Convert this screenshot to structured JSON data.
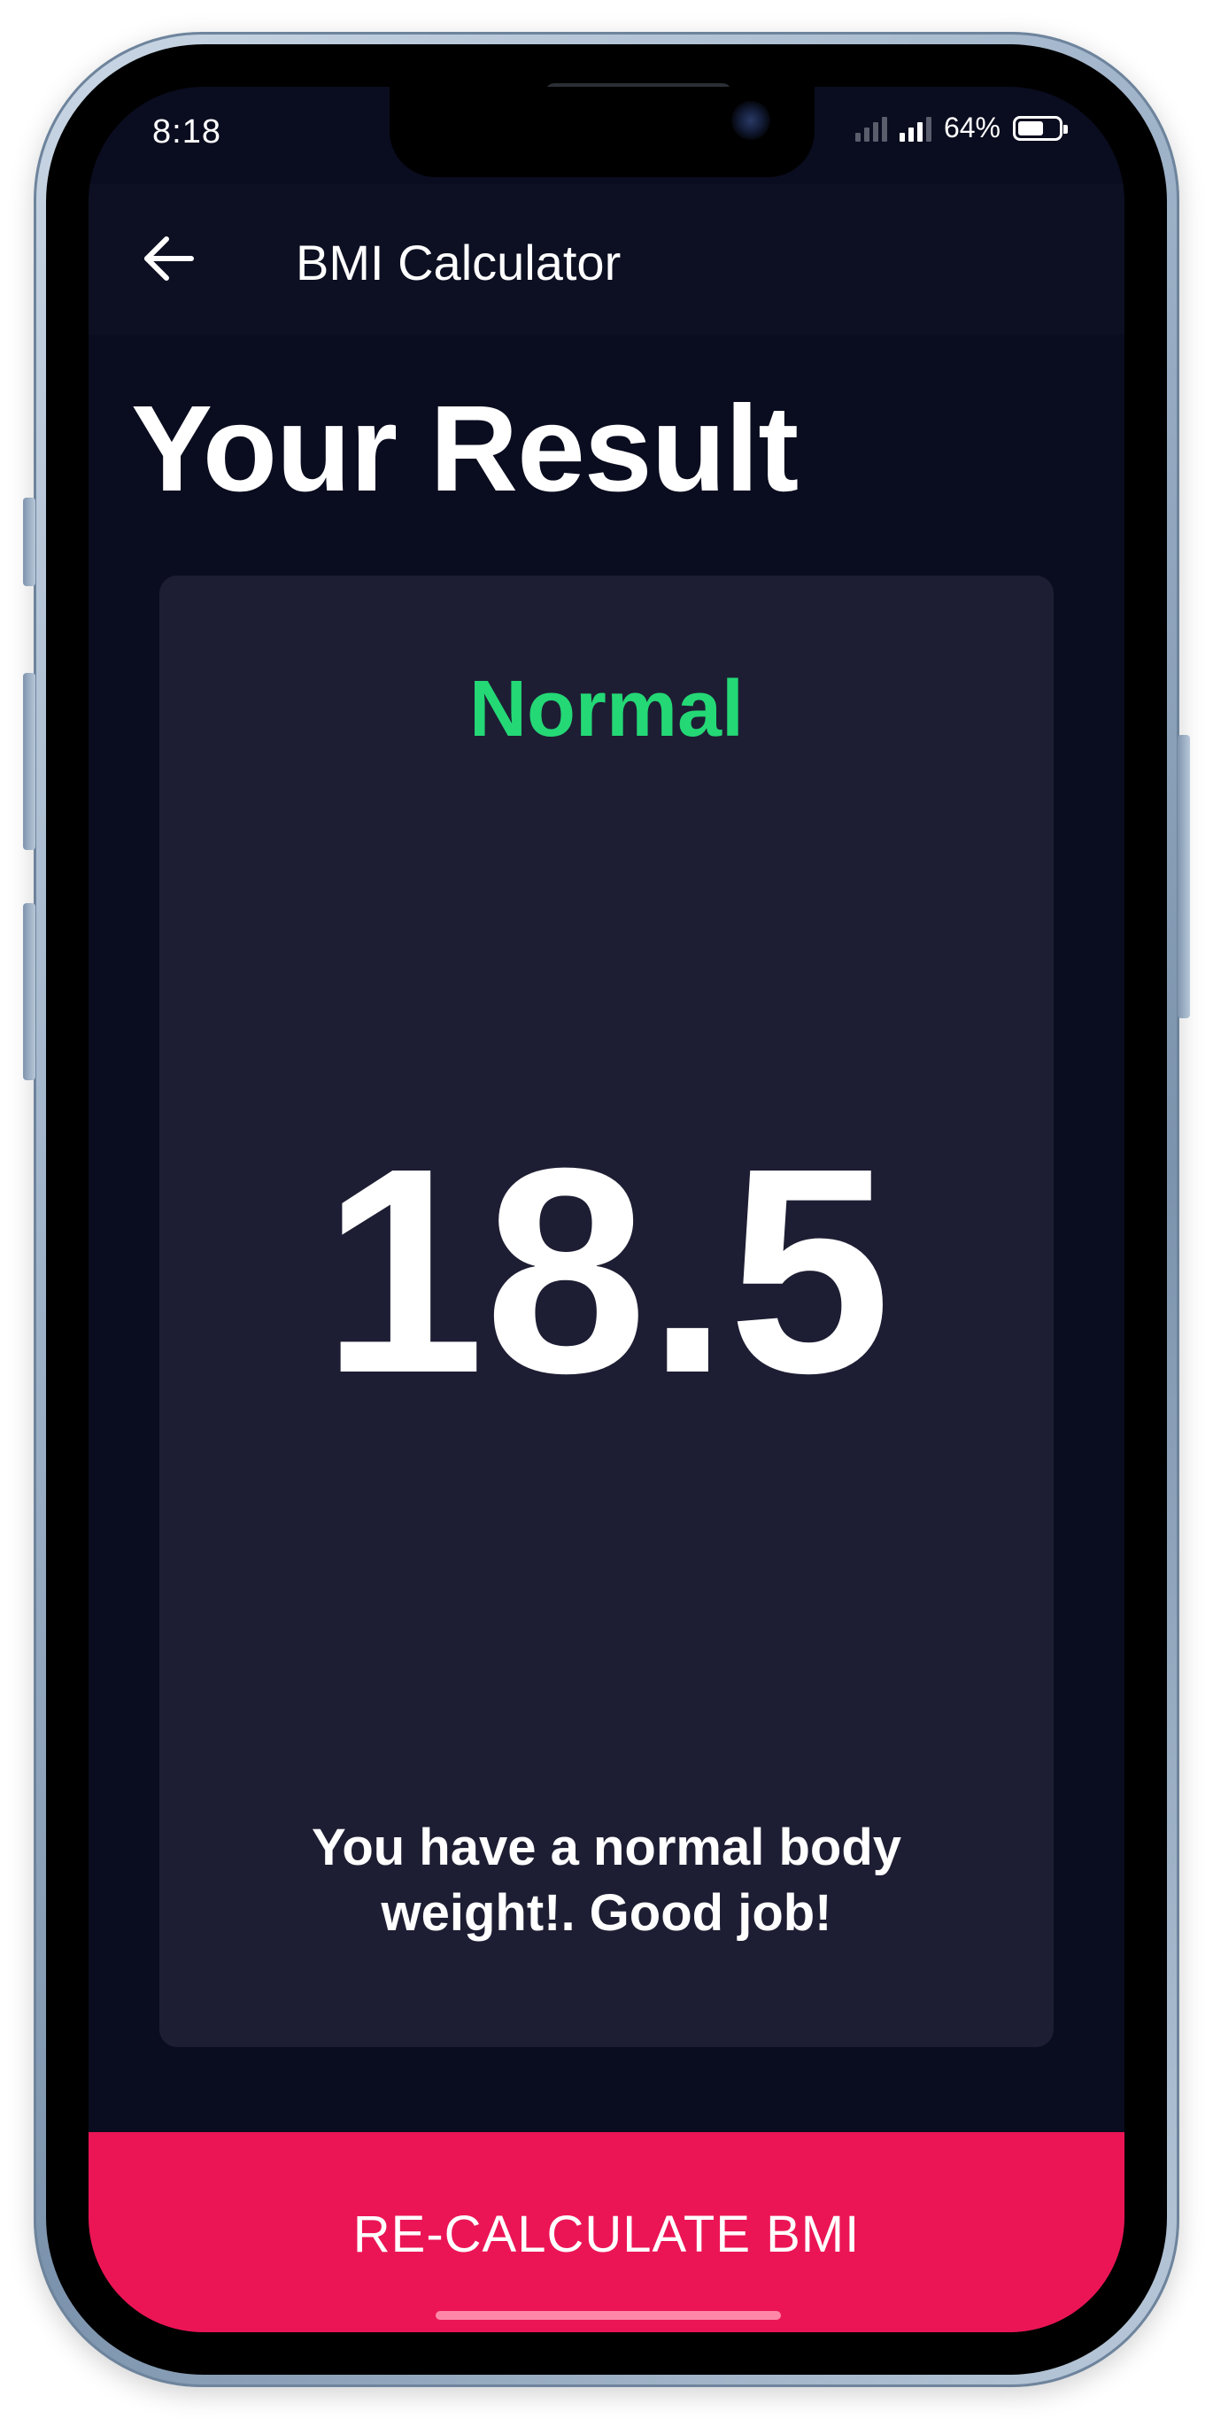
{
  "status_bar": {
    "time": "8:18",
    "battery_text": "64%",
    "battery_level": 0.64
  },
  "app_bar": {
    "title": "BMI Calculator",
    "back_icon": "arrow-left-icon"
  },
  "page": {
    "heading": "Your Result"
  },
  "result": {
    "category": "Normal",
    "bmi_value": "18.5",
    "message": "You have a normal body weight!. Good job!"
  },
  "actions": {
    "recalculate_label": "RE-CALCULATE BMI"
  },
  "colors": {
    "background": "#0a0c1f",
    "card": "#1d1e33",
    "normal_status": "#24d876",
    "button": "#eb1555"
  }
}
